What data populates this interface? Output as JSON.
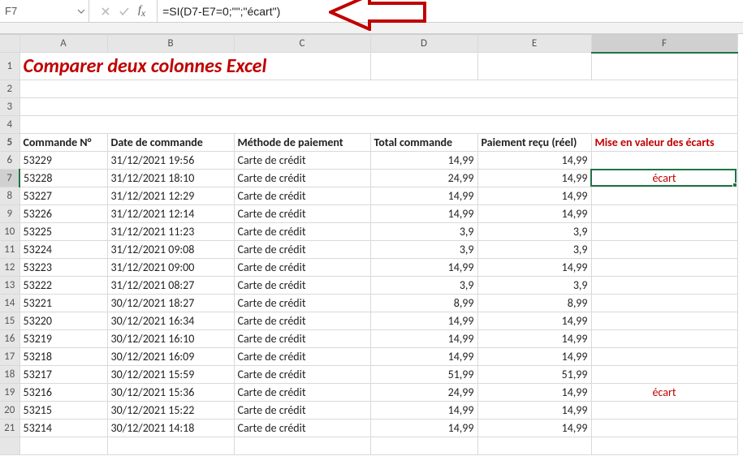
{
  "formula_bar": {
    "name_box": "F7",
    "formula": "=SI(D7-E7=0;\"\";\"écart\")"
  },
  "columns": [
    "A",
    "B",
    "C",
    "D",
    "E",
    "F"
  ],
  "selected_col": "F",
  "selected_row": 7,
  "title": "Comparer deux colonnes Excel",
  "headers": {
    "A": "Commande N°",
    "B": "Date de commande",
    "C": "Méthode de paiement",
    "D": "Total commande",
    "E": "Paiement reçu (réel)",
    "F": "Mise en valeur des écarts"
  },
  "rows": [
    {
      "n": 6,
      "A": "53229",
      "B": "31/12/2021 19:56",
      "C": "Carte de crédit",
      "D": "14,99",
      "E": "14,99",
      "F": ""
    },
    {
      "n": 7,
      "A": "53228",
      "B": "31/12/2021 18:10",
      "C": "Carte de crédit",
      "D": "24,99",
      "E": "14,99",
      "F": "écart"
    },
    {
      "n": 8,
      "A": "53227",
      "B": "31/12/2021 12:29",
      "C": "Carte de crédit",
      "D": "14,99",
      "E": "14,99",
      "F": ""
    },
    {
      "n": 9,
      "A": "53226",
      "B": "31/12/2021 12:14",
      "C": "Carte de crédit",
      "D": "14,99",
      "E": "14,99",
      "F": ""
    },
    {
      "n": 10,
      "A": "53225",
      "B": "31/12/2021 11:23",
      "C": "Carte de crédit",
      "D": "3,9",
      "E": "3,9",
      "F": ""
    },
    {
      "n": 11,
      "A": "53224",
      "B": "31/12/2021 09:08",
      "C": "Carte de crédit",
      "D": "3,9",
      "E": "3,9",
      "F": ""
    },
    {
      "n": 12,
      "A": "53223",
      "B": "31/12/2021 09:00",
      "C": "Carte de crédit",
      "D": "14,99",
      "E": "14,99",
      "F": ""
    },
    {
      "n": 13,
      "A": "53222",
      "B": "31/12/2021 08:27",
      "C": "Carte de crédit",
      "D": "3,9",
      "E": "3,9",
      "F": ""
    },
    {
      "n": 14,
      "A": "53221",
      "B": "30/12/2021 18:27",
      "C": "Carte de crédit",
      "D": "8,99",
      "E": "8,99",
      "F": ""
    },
    {
      "n": 15,
      "A": "53220",
      "B": "30/12/2021 16:34",
      "C": "Carte de crédit",
      "D": "14,99",
      "E": "14,99",
      "F": ""
    },
    {
      "n": 16,
      "A": "53219",
      "B": "30/12/2021 16:10",
      "C": "Carte de crédit",
      "D": "14,99",
      "E": "14,99",
      "F": ""
    },
    {
      "n": 17,
      "A": "53218",
      "B": "30/12/2021 16:09",
      "C": "Carte de crédit",
      "D": "14,99",
      "E": "14,99",
      "F": ""
    },
    {
      "n": 18,
      "A": "53217",
      "B": "30/12/2021 15:59",
      "C": "Carte de crédit",
      "D": "51,99",
      "E": "51,99",
      "F": ""
    },
    {
      "n": 19,
      "A": "53216",
      "B": "30/12/2021 15:36",
      "C": "Carte de crédit",
      "D": "24,99",
      "E": "14,99",
      "F": "écart"
    },
    {
      "n": 20,
      "A": "53215",
      "B": "30/12/2021 15:22",
      "C": "Carte de crédit",
      "D": "14,99",
      "E": "14,99",
      "F": ""
    },
    {
      "n": 21,
      "A": "53214",
      "B": "30/12/2021 14:18",
      "C": "Carte de crédit",
      "D": "14,99",
      "E": "14,99",
      "F": ""
    }
  ]
}
